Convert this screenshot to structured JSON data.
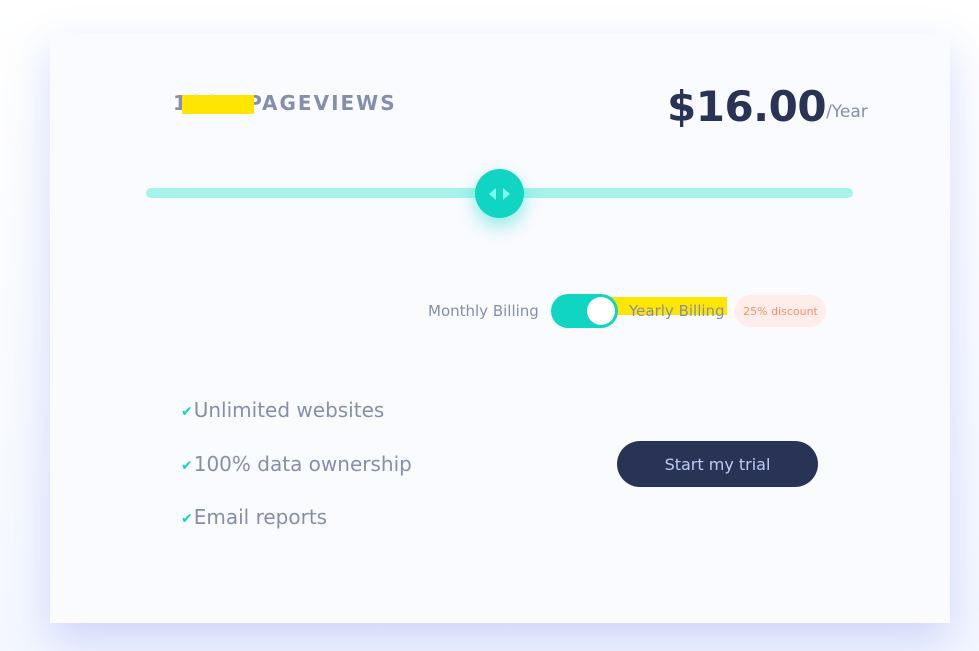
{
  "pricing": {
    "pageviews_label": "100K PAGEVIEWS",
    "price": "$16.00",
    "period": "/Year"
  },
  "slider": {
    "value_fraction": 0.5
  },
  "billing": {
    "monthly_label": "Monthly Billing",
    "yearly_label": "Yearly Billing",
    "discount_badge": "25% discount",
    "yearly_selected": true
  },
  "features": [
    {
      "label": "Unlimited websites",
      "icon": "check-icon"
    },
    {
      "label": "100% data ownership",
      "icon": "check-icon"
    },
    {
      "label": "Email reports",
      "icon": "check-icon"
    }
  ],
  "cta": {
    "label": "Start my trial"
  },
  "colors": {
    "accent": "#10d5c2",
    "track": "#a5f3eb",
    "dark": "#293356",
    "muted": "#858fad",
    "discount_bg": "#feede8",
    "discount_text": "#ff8d68",
    "highlight": "#ffe600"
  }
}
